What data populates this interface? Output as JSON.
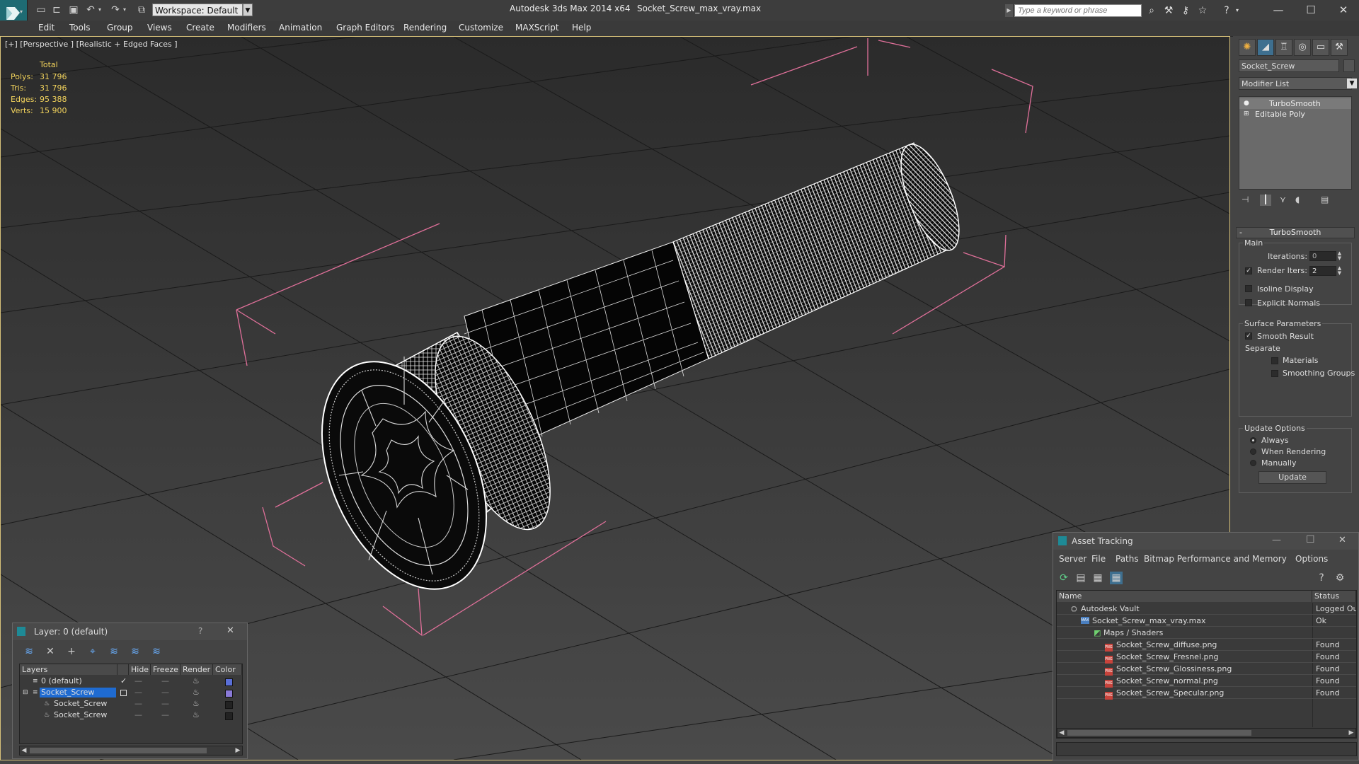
{
  "titlebar": {
    "workspace": "Workspace: Default",
    "app_title": "Autodesk 3ds Max  2014 x64",
    "file_title": "Socket_Screw_max_vray.max",
    "search_placeholder": "Type a keyword or phrase"
  },
  "menu": [
    "Edit",
    "Tools",
    "Group",
    "Views",
    "Create",
    "Modifiers",
    "Animation",
    "Graph Editors",
    "Rendering",
    "Customize",
    "MAXScript",
    "Help"
  ],
  "viewport": {
    "label": "[+] [Perspective ] [Realistic + Edged Faces ]",
    "stats": {
      "header": "Total",
      "rows": [
        {
          "label": "Polys:",
          "value": "31 796"
        },
        {
          "label": "Tris:",
          "value": "31 796"
        },
        {
          "label": "Edges:",
          "value": "95 388"
        },
        {
          "label": "Verts:",
          "value": "15 900"
        }
      ]
    }
  },
  "command_panel": {
    "object_name": "Socket_Screw",
    "modifier_list": "Modifier List",
    "stack": [
      "TurboSmooth",
      "Editable Poly"
    ],
    "turbosmooth": {
      "title": "TurboSmooth",
      "main_label": "Main",
      "iterations_label": "Iterations:",
      "iterations_value": "0",
      "render_iters_label": "Render Iters:",
      "render_iters_value": "2",
      "isoline_label": "Isoline Display",
      "explicit_normals_label": "Explicit Normals",
      "surface_params_label": "Surface Parameters",
      "smooth_result_label": "Smooth Result",
      "separate_label": "Separate",
      "materials_label": "Materials",
      "smoothing_groups_label": "Smoothing Groups",
      "update_options_label": "Update Options",
      "always_label": "Always",
      "when_rendering_label": "When Rendering",
      "manually_label": "Manually",
      "update_button": "Update"
    }
  },
  "layer_window": {
    "title": "Layer: 0 (default)",
    "help": "?",
    "close": "✕",
    "columns": [
      "Layers",
      "Hide",
      "Freeze",
      "Render",
      "Color"
    ],
    "rows": [
      {
        "name": "0 (default)",
        "color": "#5a6fd8"
      },
      {
        "name": "Socket_Screw",
        "color": "#8a7ad8"
      },
      {
        "name": "Socket_Screw",
        "color": "#222222"
      },
      {
        "name": "Socket_Screw",
        "color": "#222222"
      }
    ]
  },
  "asset_tracking": {
    "title": "Asset Tracking",
    "menu": [
      "Server",
      "File",
      "Paths",
      "Bitmap Performance and Memory",
      "Options"
    ],
    "columns": [
      "Name",
      "Status"
    ],
    "rows": [
      {
        "name": "Autodesk Vault",
        "status": "Logged Out"
      },
      {
        "name": "Socket_Screw_max_vray.max",
        "status": "Ok"
      },
      {
        "name": "Maps / Shaders",
        "status": ""
      },
      {
        "name": "Socket_Screw_diffuse.png",
        "status": "Found"
      },
      {
        "name": "Socket_Screw_Fresnel.png",
        "status": "Found"
      },
      {
        "name": "Socket_Screw_Glossiness.png",
        "status": "Found"
      },
      {
        "name": "Socket_Screw_normal.png",
        "status": "Found"
      },
      {
        "name": "Socket_Screw_Specular.png",
        "status": "Found"
      }
    ]
  }
}
